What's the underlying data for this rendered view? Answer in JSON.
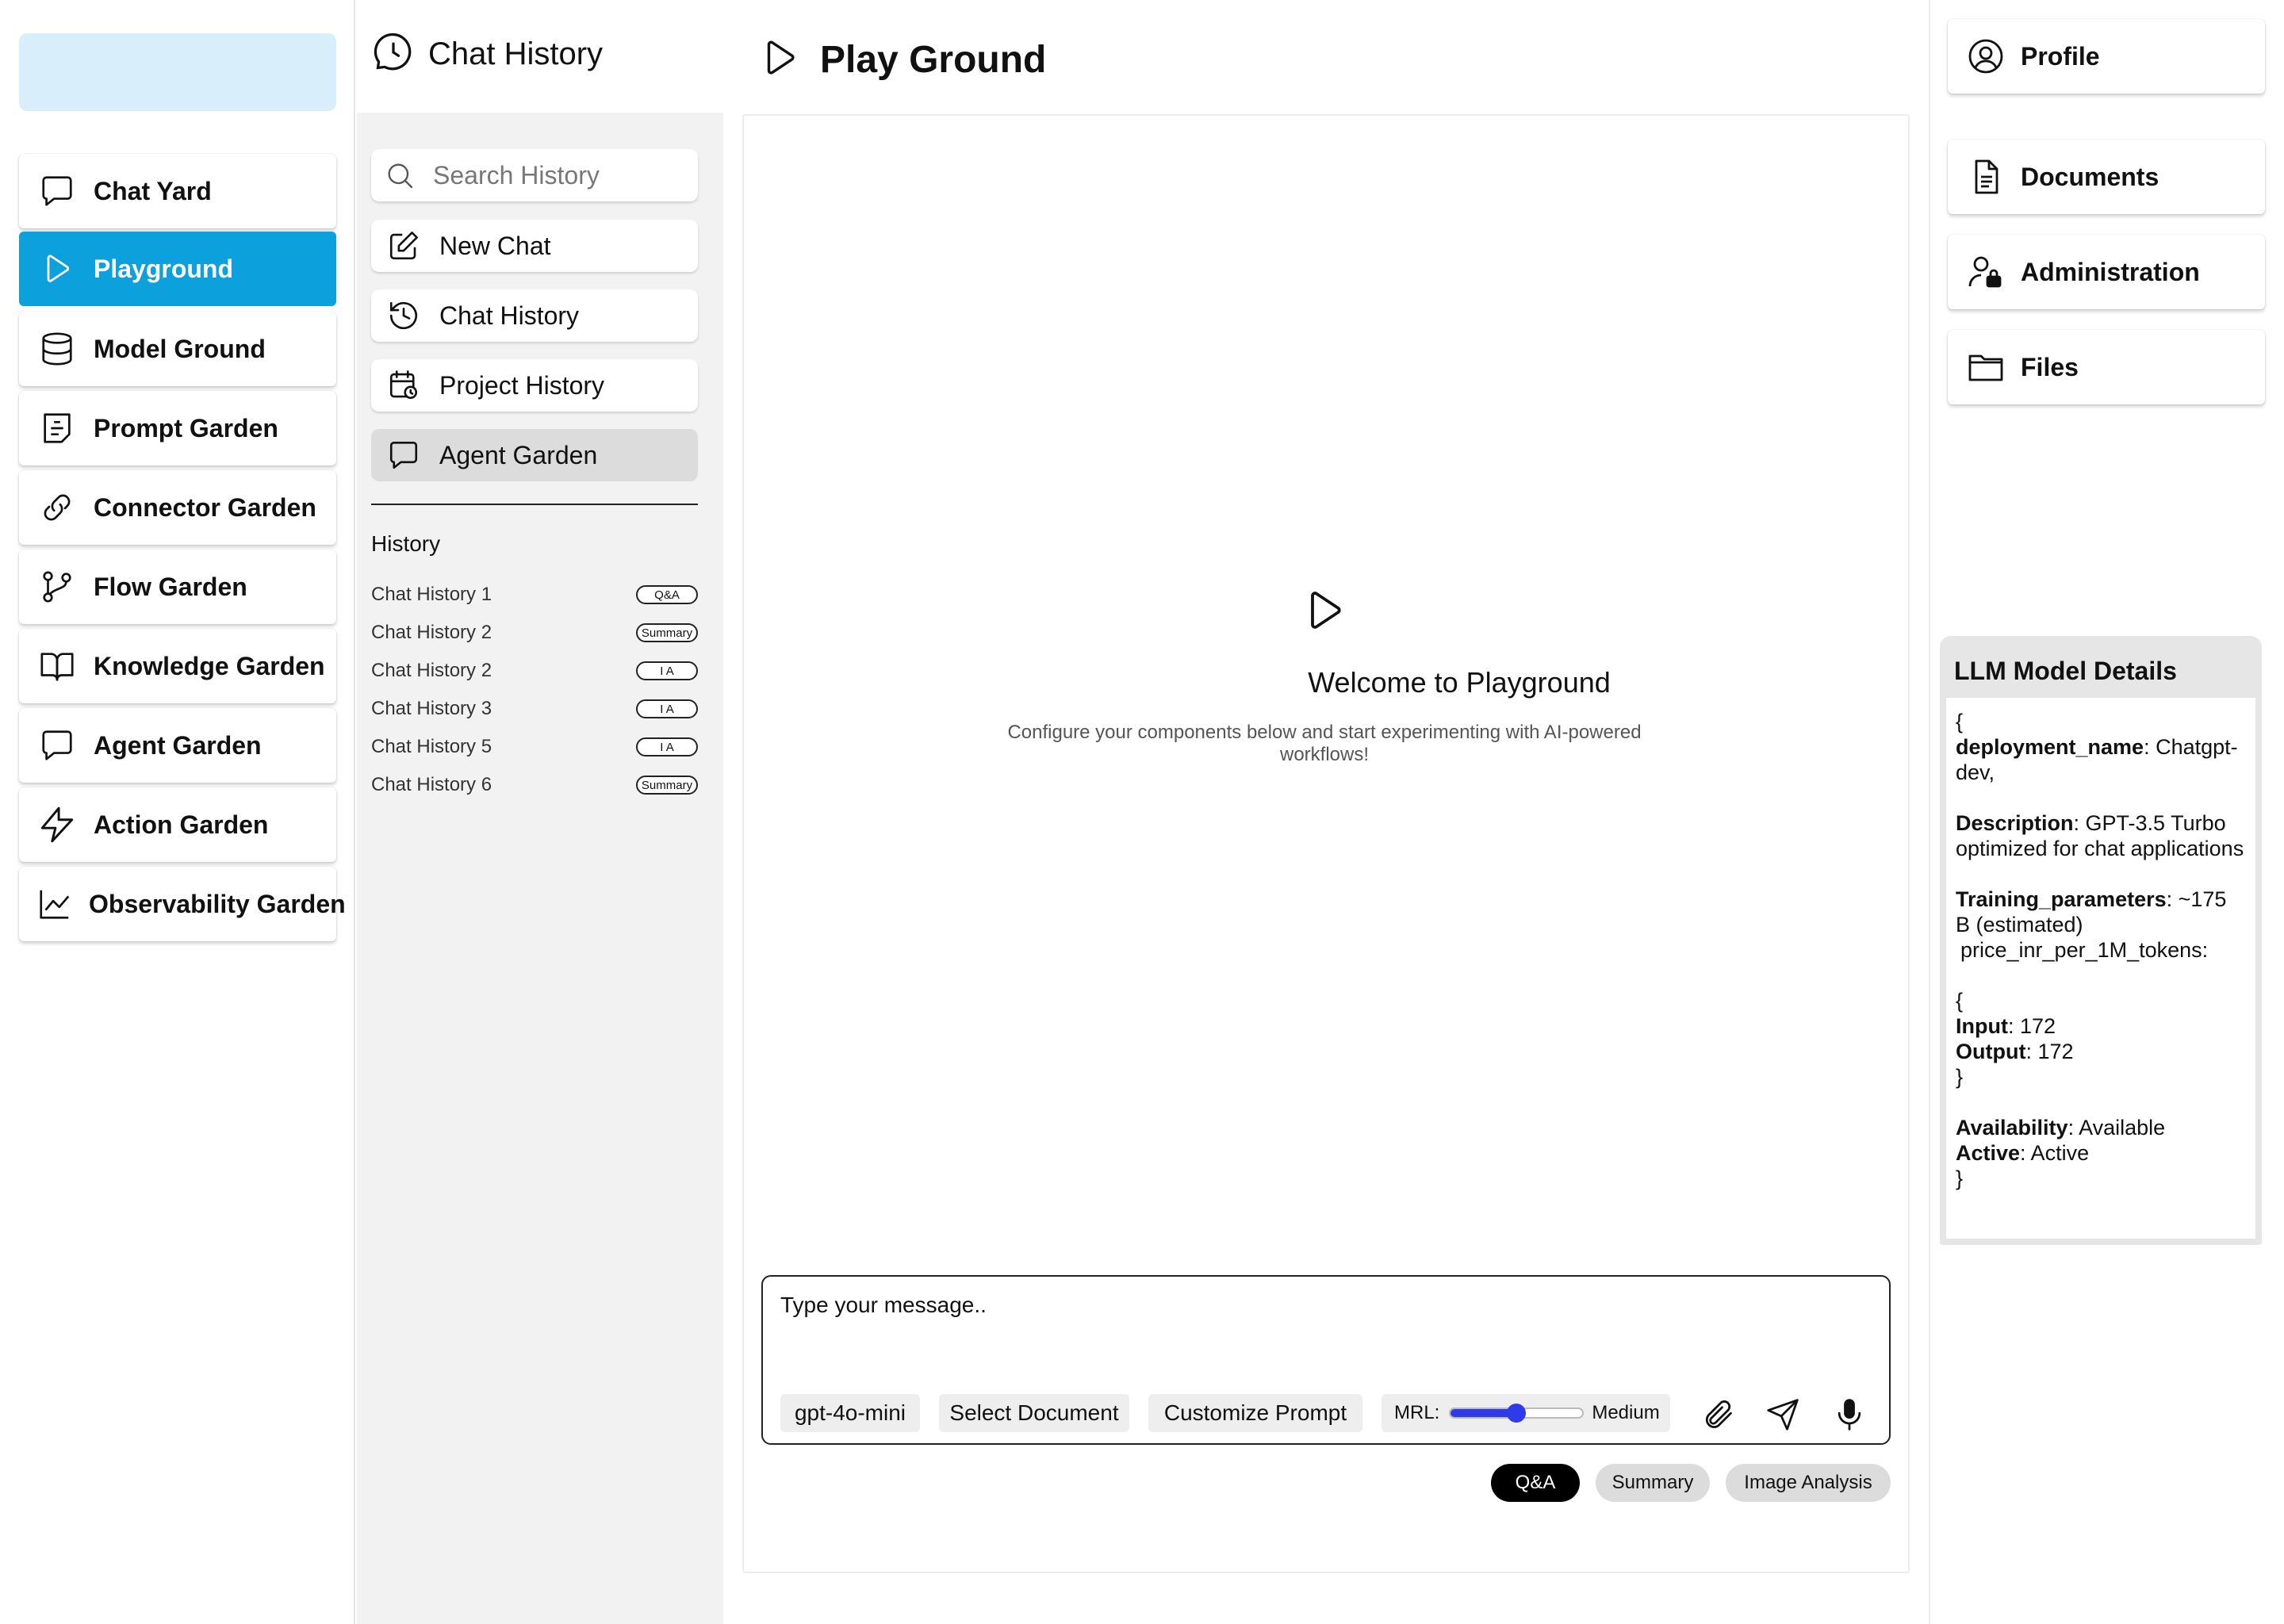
{
  "left_nav": {
    "items": [
      {
        "label": "Chat Yard",
        "icon": "chat-bubble-icon"
      },
      {
        "label": "Playground",
        "icon": "play-icon",
        "active": true
      },
      {
        "label": "Model Ground",
        "icon": "database-icon"
      },
      {
        "label": "Prompt Garden",
        "icon": "note-icon"
      },
      {
        "label": "Connector Garden",
        "icon": "link-icon"
      },
      {
        "label": "Flow Garden",
        "icon": "git-branch-icon"
      },
      {
        "label": "Knowledge Garden",
        "icon": "book-icon"
      },
      {
        "label": "Agent Garden",
        "icon": "chat-bubble-icon"
      },
      {
        "label": "Action Garden",
        "icon": "lightning-icon"
      },
      {
        "label": "Observability Garden",
        "icon": "line-chart-icon"
      }
    ],
    "active_color": "#0ca0dd"
  },
  "history_panel": {
    "title": "Chat History",
    "search_placeholder": "Search History",
    "buttons": [
      {
        "label": "New Chat",
        "icon": "edit-icon"
      },
      {
        "label": "Chat History",
        "icon": "history-icon"
      },
      {
        "label": "Project History",
        "icon": "calendar-clock-icon"
      },
      {
        "label": "Agent Garden",
        "icon": "chat-bubble-icon",
        "selected": true
      }
    ],
    "section_title": "History",
    "rows": [
      {
        "name": "Chat History 1",
        "badge": "Q&A"
      },
      {
        "name": "Chat History 2",
        "badge": "Summary"
      },
      {
        "name": "Chat History 2",
        "badge": "I A"
      },
      {
        "name": "Chat History 3",
        "badge": "I A"
      },
      {
        "name": "Chat History 5",
        "badge": "I A"
      },
      {
        "name": "Chat History 6",
        "badge": "Summary"
      }
    ]
  },
  "main": {
    "title": "Play Ground",
    "welcome_title": "Welcome to Playground",
    "welcome_subtitle": "Configure your components below and start experimenting with AI-powered workflows!",
    "composer": {
      "placeholder": "Type your message..",
      "model": "gpt-4o-mini",
      "select_document": "Select Document",
      "customize_prompt": "Customize Prompt",
      "mrl_label": "MRL:",
      "mrl_value": "Medium",
      "mrl_level": 0.5
    },
    "modes": [
      {
        "label": "Q&A",
        "active": true
      },
      {
        "label": "Summary",
        "active": false
      },
      {
        "label": "Image Analysis",
        "active": false
      }
    ],
    "accent_color": "#2f3be8"
  },
  "right_panel": {
    "items": [
      {
        "label": "Profile",
        "icon": "user-circle-icon"
      },
      {
        "label": "Documents",
        "icon": "document-icon"
      },
      {
        "label": "Administration",
        "icon": "user-lock-icon"
      },
      {
        "label": "Files",
        "icon": "folder-icon"
      }
    ],
    "details": {
      "title": "LLM Model Details",
      "open_brace": "{",
      "close_brace": "}",
      "deployment_key": "deployment_name",
      "deployment_val": ": Chatgpt-dev,",
      "description_key": "Description",
      "description_val": ": GPT-3.5 Turbo optimized for chat applications",
      "training_key": "Training_parameters",
      "training_val": ": ~175 B (estimated)",
      "price_key": "price_inr_per_1M_tokens:",
      "input_key": "Input",
      "input_val": ": 172",
      "output_key": "Output",
      "output_val": ": 172",
      "availability_key": "Availability",
      "availability_val": ": Available",
      "active_key": "Active",
      "active_val": ": Active"
    }
  }
}
